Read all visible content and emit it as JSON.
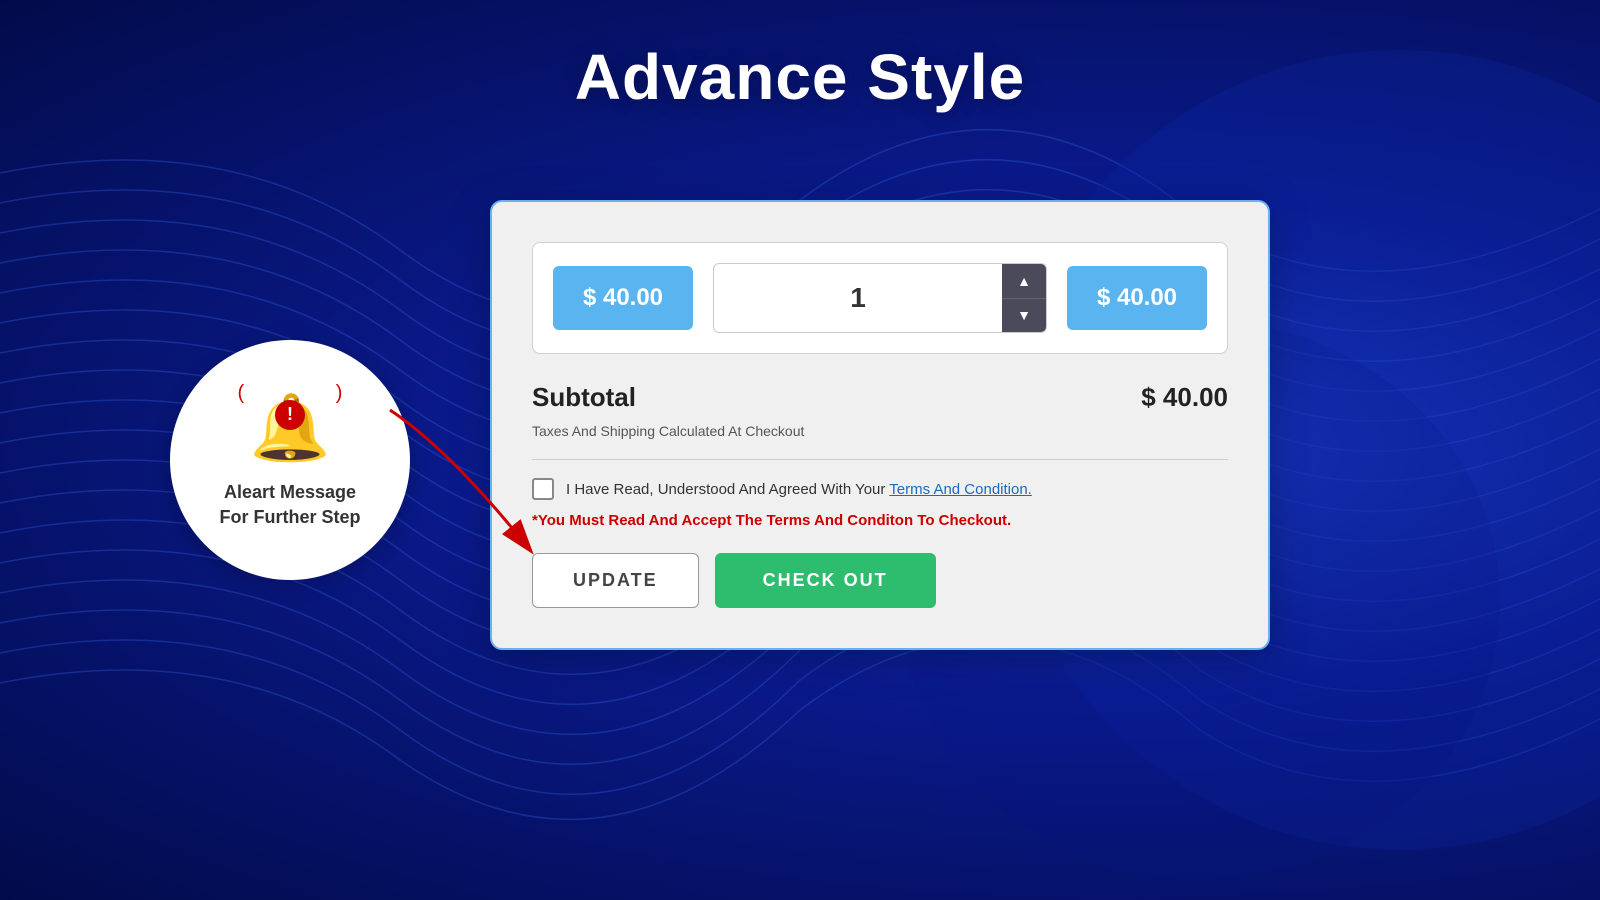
{
  "page": {
    "title": "Advance Style",
    "background_color": "#0a1a8c"
  },
  "alert_bubble": {
    "icon": "🔔",
    "exclamation": "!",
    "line1": "Aleart Message",
    "line2": "For Further Step"
  },
  "cart": {
    "unit_price": "$ 40.00",
    "quantity": "1",
    "total_item": "$ 40.00",
    "subtotal_label": "Subtotal",
    "subtotal_value": "$ 40.00",
    "taxes_text": "Taxes And Shipping Calculated At Checkout",
    "terms_text": "I Have Read, Understood And Agreed With Your ",
    "terms_link": "Terms And Condition.",
    "alert_text": "*You Must Read And Accept The Terms And Conditon To Checkout.",
    "btn_update": "UPDATE",
    "btn_checkout": "CHECK OUT"
  }
}
